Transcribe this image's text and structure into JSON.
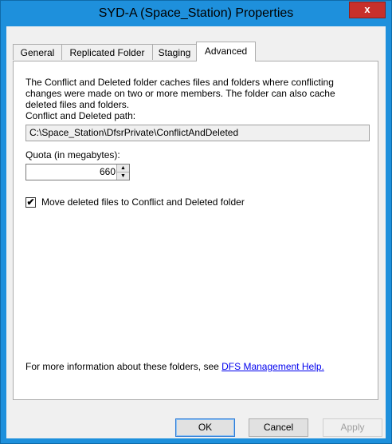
{
  "window": {
    "title": "SYD-A (Space_Station) Properties",
    "close_glyph": "x"
  },
  "tabs": [
    {
      "label": "General",
      "active": false
    },
    {
      "label": "Replicated Folder",
      "active": false
    },
    {
      "label": "Staging",
      "active": false
    },
    {
      "label": "Advanced",
      "active": true
    }
  ],
  "advanced": {
    "description": "The Conflict and Deleted folder caches files and folders where conflicting changes were made on two or more members. The folder can also cache deleted files and folders.",
    "path_label": "Conflict and Deleted path:",
    "path_value": "C:\\Space_Station\\DfsrPrivate\\ConflictAndDeleted",
    "quota_label": "Quota (in megabytes):",
    "quota_value": "660",
    "move_deleted_label": "Move deleted files to Conflict and Deleted folder",
    "move_deleted_checked": true,
    "info_text": "For more information about these folders, see ",
    "info_link": "DFS Management Help."
  },
  "buttons": {
    "ok": "OK",
    "cancel": "Cancel",
    "apply": "Apply"
  },
  "colors": {
    "titlebar": "#1e90dc",
    "close": "#c7302b",
    "link": "#0000ee"
  }
}
